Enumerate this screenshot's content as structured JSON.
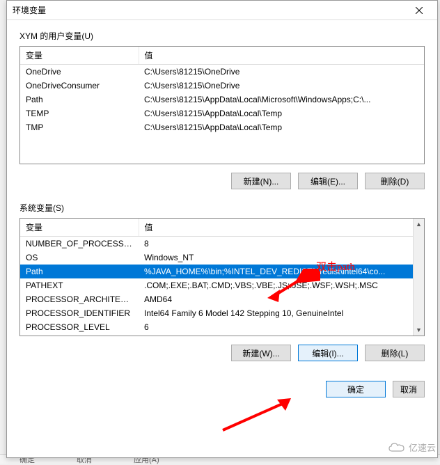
{
  "dialog": {
    "title": "环境变量"
  },
  "userSection": {
    "label": "XYM 的用户变量(U)",
    "columns": {
      "var": "变量",
      "val": "值"
    },
    "rows": [
      {
        "var": "OneDrive",
        "val": "C:\\Users\\81215\\OneDrive"
      },
      {
        "var": "OneDriveConsumer",
        "val": "C:\\Users\\81215\\OneDrive"
      },
      {
        "var": "Path",
        "val": "C:\\Users\\81215\\AppData\\Local\\Microsoft\\WindowsApps;C:\\..."
      },
      {
        "var": "TEMP",
        "val": "C:\\Users\\81215\\AppData\\Local\\Temp"
      },
      {
        "var": "TMP",
        "val": "C:\\Users\\81215\\AppData\\Local\\Temp"
      }
    ],
    "buttons": {
      "new": "新建(N)...",
      "edit": "编辑(E)...",
      "delete": "删除(D)"
    }
  },
  "sysSection": {
    "label": "系统变量(S)",
    "columns": {
      "var": "变量",
      "val": "值"
    },
    "rows": [
      {
        "var": "NUMBER_OF_PROCESSORS",
        "val": "8"
      },
      {
        "var": "OS",
        "val": "Windows_NT"
      },
      {
        "var": "Path",
        "val": "%JAVA_HOME%\\bin;%INTEL_DEV_REDIST%redist\\intel64\\co...",
        "selected": true
      },
      {
        "var": "PATHEXT",
        "val": ".COM;.EXE;.BAT;.CMD;.VBS;.VBE;.JS;.JSE;.WSF;.WSH;.MSC"
      },
      {
        "var": "PROCESSOR_ARCHITECT...",
        "val": "AMD64"
      },
      {
        "var": "PROCESSOR_IDENTIFIER",
        "val": "Intel64 Family 6 Model 142 Stepping 10, GenuineIntel"
      },
      {
        "var": "PROCESSOR_LEVEL",
        "val": "6"
      }
    ],
    "buttons": {
      "new": "新建(W)...",
      "edit": "编辑(I)...",
      "delete": "删除(L)"
    }
  },
  "footer": {
    "ok": "确定",
    "cancel": "取消"
  },
  "annotations": {
    "doubleClickPath": "双击path"
  },
  "watermark": "亿速云",
  "bgButtons": {
    "a": "确定",
    "b": "取消",
    "c": "应用(A)"
  }
}
